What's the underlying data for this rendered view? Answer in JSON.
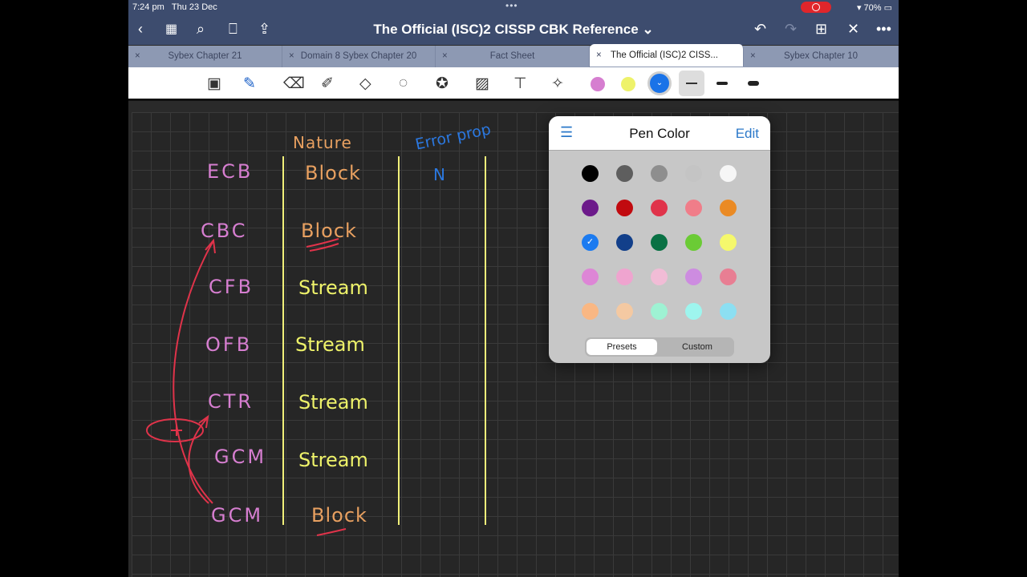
{
  "status": {
    "time": "7:24 pm",
    "date": "Thu 23 Dec",
    "battery": "70%"
  },
  "nav": {
    "title": "The Official (ISC)2 CISSP CBK Reference ⌄"
  },
  "tabs": [
    {
      "label": "Sybex Chapter 21"
    },
    {
      "label": "Domain 8 Sybex Chapter 20"
    },
    {
      "label": "Fact Sheet"
    },
    {
      "label": "The Official (ISC)2 CISS..."
    },
    {
      "label": "Sybex Chapter 10"
    }
  ],
  "toolbar": {
    "colors": [
      "#d67ed0",
      "#eef26a",
      "#1a73e8"
    ]
  },
  "notes": {
    "nature": "Nature",
    "error_prop": "Error prop",
    "n": "N",
    "rows": [
      {
        "mode": "ECB",
        "nature": "Block"
      },
      {
        "mode": "CBC",
        "nature": "Block"
      },
      {
        "mode": "CFB",
        "nature": "Stream"
      },
      {
        "mode": "OFB",
        "nature": "Stream"
      },
      {
        "mode": "CTR",
        "nature": "Stream"
      },
      {
        "mode": "GCM",
        "nature": "Stream"
      },
      {
        "mode": "GCM",
        "nature": "Block"
      }
    ]
  },
  "popup": {
    "title": "Pen Color",
    "edit": "Edit",
    "presets": "Presets",
    "custom": "Custom",
    "colors": [
      "#000000",
      "#5e5e5e",
      "#8e8e8e",
      "#c4c4c4",
      "#f6f6f6",
      "#6c1a8a",
      "#c10a0f",
      "#e0334a",
      "#f07d89",
      "#ea8a24",
      "#1c7bf0",
      "#123f8a",
      "#097144",
      "#6bcb35",
      "#f5f86c",
      "#dd86d6",
      "#efa4cf",
      "#f1bcd6",
      "#cd8ce0",
      "#e87e93",
      "#f9b783",
      "#f4c9a2",
      "#9ef2d3",
      "#9ef5ee",
      "#8cdff2"
    ],
    "selected_index": 10
  }
}
